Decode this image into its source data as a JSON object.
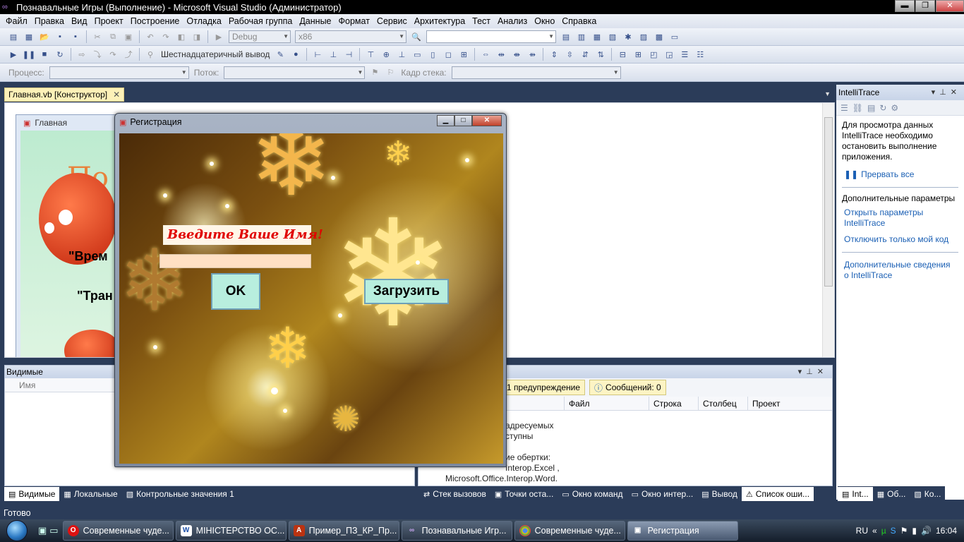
{
  "window": {
    "title": "Познавальные Игры (Выполнение) - Microsoft Visual Studio (Администратор)",
    "minimize": "▬",
    "maximize": "❐",
    "close": "✕"
  },
  "menu": [
    "Файл",
    "Правка",
    "Вид",
    "Проект",
    "Построение",
    "Отладка",
    "Рабочая группа",
    "Данные",
    "Формат",
    "Сервис",
    "Архитектура",
    "Тест",
    "Анализ",
    "Окно",
    "Справка"
  ],
  "toolbar1": {
    "config": "Debug",
    "platform": "x86",
    "find_value": ""
  },
  "toolbar2": {
    "hex_label": "Шестнадцатеричный вывод"
  },
  "toolbar3": {
    "process_label": "Процесс:",
    "thread_label": "Поток:",
    "stack_label": "Кадр стека:"
  },
  "document": {
    "tab_label": "Главная.vb [Конструктор]",
    "form_title": "Главная",
    "form_heading_fragment": "По",
    "form_text1": "\"Врем",
    "form_text2": "\"Тран"
  },
  "dialog": {
    "title": "Регистрация",
    "name_label": "Введите Ваше Имя!",
    "name_value": "",
    "ok_label": "OK",
    "load_label": "Загрузить"
  },
  "intellitrace": {
    "title": "IntelliTrace",
    "info": "Для просмотра данных IntelliTrace необходимо остановить выполнение приложения.",
    "break_all": "Прервать все",
    "additional": "Дополнительные параметры",
    "open_settings": "Открыть параметры IntelliTrace",
    "just_my_code": "Отключить только мой код",
    "more_info": "Дополнительные сведения о IntelliTrace"
  },
  "locals_panel": {
    "title": "Видимые",
    "col_name": "Имя"
  },
  "error_list": {
    "warnings_tab": "1 предупреждение",
    "messages_tab": "Сообщений: 0",
    "columns": [
      "Файл",
      "Строка",
      "Столбец",
      "Проект"
    ],
    "message_lines": [
      "адресуемых",
      "ступны",
      "",
      "ие обертки:",
      "Interop.Excel ,",
      "Microsoft.Office.Interop.Word."
    ]
  },
  "bottom_tabs_left": [
    "Видимые",
    "Локальные",
    "Контрольные значения 1"
  ],
  "bottom_tabs_right": [
    "Стек вызовов",
    "Точки оста...",
    "Окно команд",
    "Окно интер...",
    "Вывод",
    "Список оши..."
  ],
  "bottom_tabs_side": [
    "Int...",
    "Об...",
    "Ко..."
  ],
  "status": "Готово",
  "taskbar": {
    "tasks": [
      "Современные чуде...",
      "МІНІСТЕРСТВО ОС...",
      "Пример_ПЗ_КР_Пр...",
      "Познавальные Игр...",
      "Современные чуде...",
      "Регистрация"
    ],
    "lang": "RU",
    "time": "16:04"
  }
}
